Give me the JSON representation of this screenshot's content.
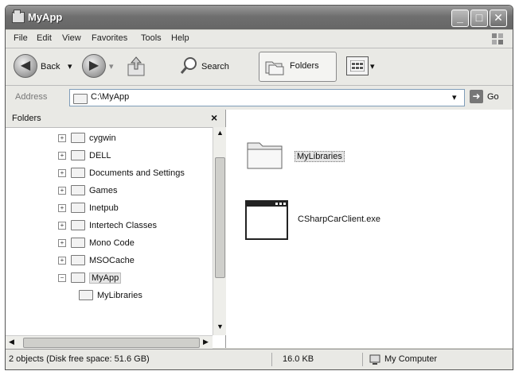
{
  "window": {
    "title": "MyApp"
  },
  "menu": [
    "File",
    "Edit",
    "View",
    "Favorites",
    "Tools",
    "Help"
  ],
  "toolbar": {
    "back": "Back",
    "search": "Search",
    "folders": "Folders"
  },
  "address": {
    "label": "Address",
    "value": "C:\\MyApp",
    "go": "Go"
  },
  "folders_pane": {
    "title": "Folders",
    "items": [
      {
        "label": "cygwin",
        "expander": "+",
        "indent": 1
      },
      {
        "label": "DELL",
        "expander": "+",
        "indent": 1
      },
      {
        "label": "Documents and Settings",
        "expander": "+",
        "indent": 1
      },
      {
        "label": "Games",
        "expander": "+",
        "indent": 1
      },
      {
        "label": "Inetpub",
        "expander": "+",
        "indent": 1
      },
      {
        "label": "Intertech Classes",
        "expander": "+",
        "indent": 1
      },
      {
        "label": "Mono Code",
        "expander": "+",
        "indent": 1
      },
      {
        "label": "MSOCache",
        "expander": "+",
        "indent": 1
      },
      {
        "label": "MyApp",
        "expander": "−",
        "indent": 1,
        "selected": true
      },
      {
        "label": "MyLibraries",
        "expander": "",
        "indent": 2
      }
    ]
  },
  "files": [
    {
      "name": "MyLibraries",
      "type": "folder",
      "icon": "folder-icon",
      "selected": true
    },
    {
      "name": "CSharpCarClient.exe",
      "type": "exe",
      "icon": "application-window-icon"
    }
  ],
  "status": {
    "summary": "2 objects (Disk free space: 51.6 GB)",
    "size": "16.0 KB",
    "zone": "My Computer"
  },
  "colors": {
    "title_bar": "#7a7a7a",
    "selection": "#e6e6e6"
  }
}
